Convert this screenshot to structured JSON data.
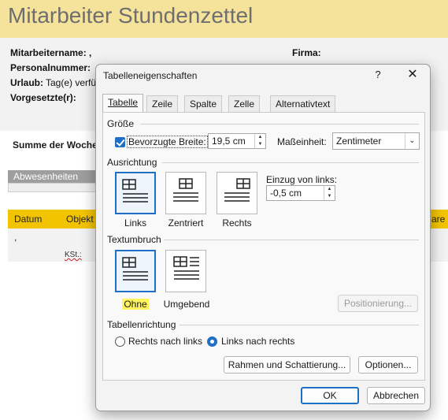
{
  "document": {
    "title": "Mitarbeiter Stundenzettel",
    "fields": {
      "mitarbeitername": "Mitarbeitername: ,",
      "firma": "Firma:",
      "personalnummer": "Personalnummer:",
      "urlaub_label": "Urlaub:",
      "urlaub_value": "Tag(e) verfü",
      "vorgesetzte": "Vorgesetzte(r):"
    },
    "summe": "Summe der Wocher",
    "abwesenheiten": "Abwesenheiten",
    "table_headers": [
      "Datum",
      "Objekt",
      "are"
    ],
    "row_comma": ",",
    "kst": "KSt.:"
  },
  "dialog": {
    "title": "Tabelleneigenschaften",
    "help_label": "?",
    "close_label": "✕",
    "tabs": [
      {
        "label": "Tabelle",
        "active": true
      },
      {
        "label": "Zeile",
        "active": false
      },
      {
        "label": "Spalte",
        "active": false
      },
      {
        "label": "Zelle",
        "active": false
      },
      {
        "label": "Alternativtext",
        "active": false
      }
    ],
    "groesse": {
      "label": "Größe",
      "preferred_width_label": "Bevorzugte Breite:",
      "preferred_width_checked": true,
      "width_value": "19,5 cm",
      "unit_label": "Maßeinheit:",
      "unit_value": "Zentimeter"
    },
    "ausrichtung": {
      "label": "Ausrichtung",
      "options": [
        "Links",
        "Zentriert",
        "Rechts"
      ],
      "selected": "Links",
      "indent_label": "Einzug von links:",
      "indent_value": "-0,5 cm"
    },
    "textumbruch": {
      "label": "Textumbruch",
      "options": [
        "Ohne",
        "Umgebend"
      ],
      "selected": "Ohne",
      "positioning_button": "Positionierung..."
    },
    "richtung": {
      "label": "Tabellenrichtung",
      "options": [
        "Rechts nach links",
        "Links nach rechts"
      ],
      "selected": "Links nach rechts"
    },
    "buttons": {
      "borders": "Rahmen und Schattierung...",
      "options": "Optionen...",
      "ok": "OK",
      "cancel": "Abbrechen"
    }
  },
  "colors": {
    "accent": "#1f6fc5",
    "doc_title_bg": "#f6e39b",
    "table_header_bg": "#f2c400",
    "highlight": "#fff45c"
  }
}
